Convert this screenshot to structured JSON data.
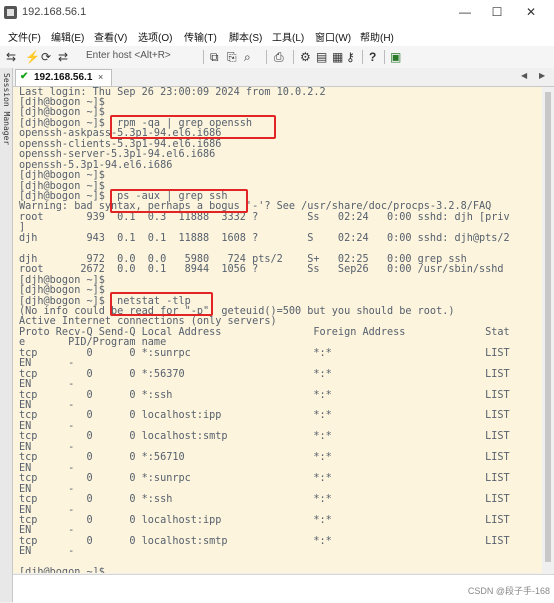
{
  "window": {
    "title": "192.168.56.1",
    "minimize": "—",
    "maximize": "☐",
    "close": "✕"
  },
  "menu": [
    {
      "label": "文件(F)"
    },
    {
      "label": "编辑(E)"
    },
    {
      "label": "查看(V)"
    },
    {
      "label": "选项(O)"
    },
    {
      "label": "传输(T)"
    },
    {
      "label": "脚本(S)"
    },
    {
      "label": "工具(L)"
    },
    {
      "label": "窗口(W)"
    },
    {
      "label": "帮助(H)"
    }
  ],
  "toolbar": {
    "host_placeholder": "Enter host <Alt+R>"
  },
  "sidebar": {
    "label": "Session Manager"
  },
  "tabs": [
    {
      "label": "192.168.56.1",
      "close": "×"
    }
  ],
  "tab_nav": {
    "left": "◀",
    "right": "▶"
  },
  "terminal": {
    "lines": [
      "Last login: Thu Sep 26 23:00:09 2024 from 10.0.2.2",
      "[djh@bogon ~]$",
      "[djh@bogon ~]$",
      "[djh@bogon ~]$  rpm -qa | grep openssh",
      "openssh-askpass-5.3p1-94.el6.i686",
      "openssh-clients-5.3p1-94.el6.i686",
      "openssh-server-5.3p1-94.el6.i686",
      "openssh-5.3p1-94.el6.i686",
      "[djh@bogon ~]$",
      "[djh@bogon ~]$",
      "[djh@bogon ~]$  ps -aux | grep ssh",
      "Warning: bad syntax, perhaps a bogus '-'? See /usr/share/doc/procps-3.2.8/FAQ",
      "root       939  0.1  0.3  11888  3332 ?        Ss   02:24   0:00 sshd: djh [priv",
      "]",
      "djh        943  0.1  0.1  11888  1608 ?        S    02:24   0:00 sshd: djh@pts/2",
      "",
      "djh        972  0.0  0.0   5980   724 pts/2    S+   02:25   0:00 grep ssh",
      "root      2672  0.0  0.1   8944  1056 ?        Ss   Sep26   0:00 /usr/sbin/sshd",
      "[djh@bogon ~]$",
      "[djh@bogon ~]$",
      "[djh@bogon ~]$  netstat -tlp",
      "(No info could be read for \"-p\": geteuid()=500 but you should be root.)",
      "Active Internet connections (only servers)",
      "Proto Recv-Q Send-Q Local Address               Foreign Address             Stat",
      "e       PID/Program name",
      "tcp        0      0 *:sunrpc                    *:*                         LIST",
      "EN      -",
      "tcp        0      0 *:56370                     *:*                         LIST",
      "EN      -",
      "tcp        0      0 *:ssh                       *:*                         LIST",
      "EN      -",
      "tcp        0      0 localhost:ipp               *:*                         LIST",
      "EN      -",
      "tcp        0      0 localhost:smtp              *:*                         LIST",
      "EN      -",
      "tcp        0      0 *:56710                     *:*                         LIST",
      "EN      -",
      "tcp        0      0 *:sunrpc                    *:*                         LIST",
      "EN      -",
      "tcp        0      0 *:ssh                       *:*                         LIST",
      "EN      -",
      "tcp        0      0 localhost:ipp               *:*                         LIST",
      "EN      -",
      "tcp        0      0 localhost:smtp              *:*                         LIST",
      "EN      -",
      "",
      "[djh@bogon ~]$"
    ]
  },
  "watermark": "CSDN @段子手-168"
}
